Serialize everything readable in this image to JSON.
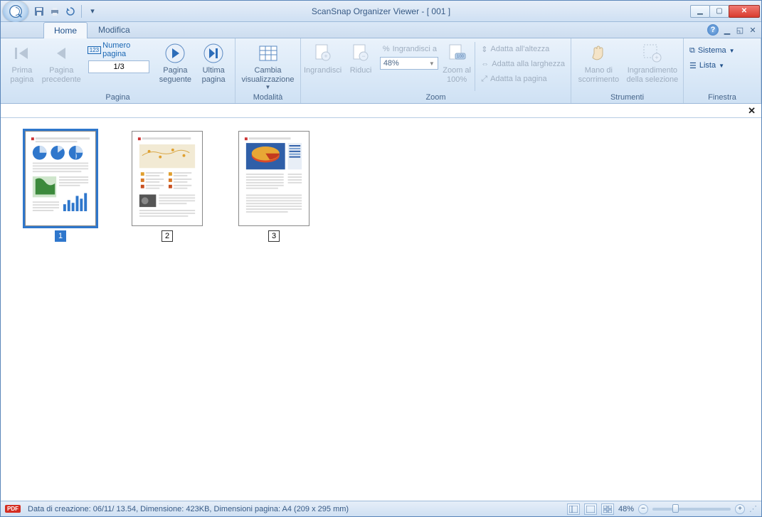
{
  "title": "ScanSnap Organizer Viewer - [ 001 ]",
  "tabs": {
    "home": "Home",
    "edit": "Modifica"
  },
  "ribbon": {
    "page": {
      "group": "Pagina",
      "first": "Prima pagina",
      "prev": "Pagina precedente",
      "pagecount_label": "Numero pagina",
      "pagecount_value": "1/3",
      "next": "Pagina seguente",
      "last": "Ultima pagina"
    },
    "mode": {
      "group": "Modalità",
      "change": "Cambia visualizzazione"
    },
    "zoom": {
      "group": "Zoom",
      "in": "Ingrandisci",
      "out": "Riduci",
      "to_label": "Ingrandisci a",
      "value": "48%",
      "to100": "Zoom al 100%",
      "fit_height": "Adatta all'altezza",
      "fit_width": "Adatta alla larghezza",
      "fit_page": "Adatta la pagina"
    },
    "tools": {
      "group": "Strumenti",
      "hand": "Mano di scorrimento",
      "marquee": "Ingrandimento della selezione"
    },
    "window": {
      "group": "Finestra",
      "system": "Sistema",
      "list": "Lista"
    }
  },
  "thumbs": [
    {
      "num": "1",
      "selected": true
    },
    {
      "num": "2",
      "selected": false
    },
    {
      "num": "3",
      "selected": false
    }
  ],
  "status": {
    "pdf": "PDF",
    "info": "Data di creazione: 06/11/       13.54, Dimensione: 423KB, Dimensioni pagina: A4 (209 x 295 mm)",
    "zoom": "48%"
  }
}
